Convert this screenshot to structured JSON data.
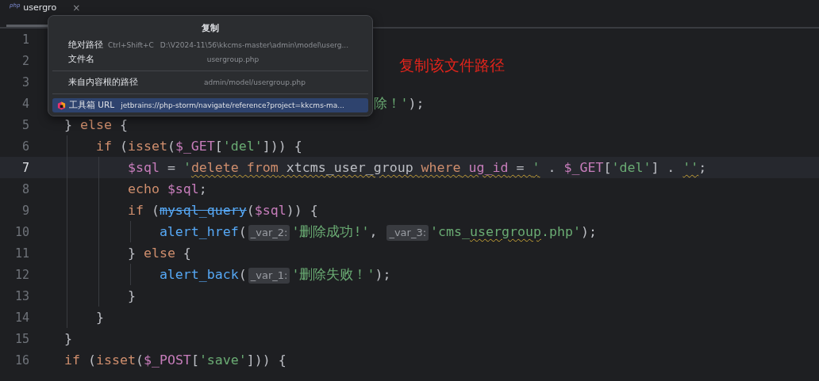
{
  "tab": {
    "icon_text": "php",
    "label": "usergro",
    "close": "×"
  },
  "code_lines": [
    {
      "number": "1",
      "current": false
    },
    {
      "number": "2",
      "current": false
    },
    {
      "number": "3",
      "current": false
    },
    {
      "number": "4",
      "current": false,
      "tokens": [
        {
          "kind": "str",
          "text": "除！'"
        },
        {
          "kind": "plain",
          "text": ");"
        }
      ]
    },
    {
      "number": "5",
      "current": false,
      "tokens": [
        {
          "kind": "plain",
          "text": "} "
        },
        {
          "kind": "kw",
          "text": "else"
        },
        {
          "kind": "plain",
          "text": " {"
        }
      ]
    },
    {
      "number": "6",
      "current": false,
      "tokens": [
        {
          "kind": "kw",
          "text": "    if"
        },
        {
          "kind": "plain",
          "text": " ("
        },
        {
          "kind": "kw",
          "text": "isset"
        },
        {
          "kind": "plain",
          "text": "("
        },
        {
          "kind": "var",
          "text": "$_GET"
        },
        {
          "kind": "plain",
          "text": "["
        },
        {
          "kind": "str",
          "text": "'del'"
        },
        {
          "kind": "plain",
          "text": "])) {"
        }
      ]
    },
    {
      "number": "7",
      "current": true,
      "tokens": [
        {
          "kind": "var",
          "text": "        $sql"
        },
        {
          "kind": "plain",
          "text": " = "
        },
        {
          "kind": "str",
          "text": "'"
        },
        {
          "kind": "kw",
          "text": "delete from",
          "wavy": true
        },
        {
          "kind": "plain",
          "text": " xtcms_user_group ",
          "wavy": true
        },
        {
          "kind": "kw",
          "text": "where",
          "wavy": true
        },
        {
          "kind": "var",
          "text": " ug_id",
          "wavy": true
        },
        {
          "kind": "plain",
          "text": " = ",
          "wavy": true
        },
        {
          "kind": "str",
          "text": "'",
          "wavy": true
        },
        {
          "kind": "plain",
          "text": " . "
        },
        {
          "kind": "var",
          "text": "$_GET"
        },
        {
          "kind": "plain",
          "text": "["
        },
        {
          "kind": "str",
          "text": "'del'"
        },
        {
          "kind": "plain",
          "text": "] . "
        },
        {
          "kind": "str",
          "text": "''",
          "wavy": true
        },
        {
          "kind": "plain",
          "text": ";"
        }
      ]
    },
    {
      "number": "8",
      "current": false,
      "tokens": [
        {
          "kind": "kw",
          "text": "        echo"
        },
        {
          "kind": "var",
          "text": " $sql"
        },
        {
          "kind": "plain",
          "text": ";"
        }
      ]
    },
    {
      "number": "9",
      "current": false,
      "tokens": [
        {
          "kind": "kw",
          "text": "        if"
        },
        {
          "kind": "plain",
          "text": " ("
        },
        {
          "kind": "deprecated",
          "text": "mysql_query"
        },
        {
          "kind": "plain",
          "text": "("
        },
        {
          "kind": "var",
          "text": "$sql"
        },
        {
          "kind": "plain",
          "text": ")) {"
        }
      ]
    },
    {
      "number": "10",
      "current": false,
      "tokens": [
        {
          "kind": "fn",
          "text": "            alert_href"
        },
        {
          "kind": "plain",
          "text": "("
        },
        {
          "kind": "hint",
          "text": "_var_2:"
        },
        {
          "kind": "str",
          "text": "'删除成功!'"
        },
        {
          "kind": "plain",
          "text": ", "
        },
        {
          "kind": "hint",
          "text": "_var_3:"
        },
        {
          "kind": "str",
          "text": "'cms_"
        },
        {
          "kind": "str",
          "text": "usergroup",
          "wavy": true
        },
        {
          "kind": "str",
          "text": ".php'"
        },
        {
          "kind": "plain",
          "text": ");"
        }
      ]
    },
    {
      "number": "11",
      "current": false,
      "tokens": [
        {
          "kind": "plain",
          "text": "        } "
        },
        {
          "kind": "kw",
          "text": "else"
        },
        {
          "kind": "plain",
          "text": " {"
        }
      ]
    },
    {
      "number": "12",
      "current": false,
      "tokens": [
        {
          "kind": "fn",
          "text": "            alert_back"
        },
        {
          "kind": "plain",
          "text": "("
        },
        {
          "kind": "hint",
          "text": "_var_1:"
        },
        {
          "kind": "str",
          "text": "'删除失败！'"
        },
        {
          "kind": "plain",
          "text": ");"
        }
      ]
    },
    {
      "number": "13",
      "current": false,
      "tokens": [
        {
          "kind": "plain",
          "text": "        }"
        }
      ]
    },
    {
      "number": "14",
      "current": false,
      "tokens": [
        {
          "kind": "plain",
          "text": "    }"
        }
      ]
    },
    {
      "number": "15",
      "current": false,
      "tokens": [
        {
          "kind": "plain",
          "text": "}"
        }
      ]
    },
    {
      "number": "16",
      "current": false,
      "tokens": [
        {
          "kind": "kw",
          "text": "if"
        },
        {
          "kind": "plain",
          "text": " ("
        },
        {
          "kind": "kw",
          "text": "isset"
        },
        {
          "kind": "plain",
          "text": "("
        },
        {
          "kind": "var",
          "text": "$_POST"
        },
        {
          "kind": "plain",
          "text": "["
        },
        {
          "kind": "str",
          "text": "'save'"
        },
        {
          "kind": "plain",
          "text": "])) {"
        }
      ]
    }
  ],
  "copy_popup": {
    "title": "复制",
    "groups": [
      [
        {
          "label": "绝对路径",
          "shortcut": "Ctrl+Shift+C",
          "value": "D:\\V2024-11\\56\\kkcms-master\\admin\\model\\userg...",
          "selected": false
        },
        {
          "label": "文件名",
          "value": "usergroup.php",
          "selected": false
        }
      ],
      [
        {
          "label": "来自内容根的路径",
          "value": "admin/model/usergroup.php",
          "selected": false
        }
      ],
      [
        {
          "label": "工具箱 URL",
          "value": "jetbrains://php-storm/navigate/reference?project=kkcms-ma...",
          "selected": true,
          "icon": true
        }
      ]
    ]
  },
  "annotation": "复制该文件路径"
}
